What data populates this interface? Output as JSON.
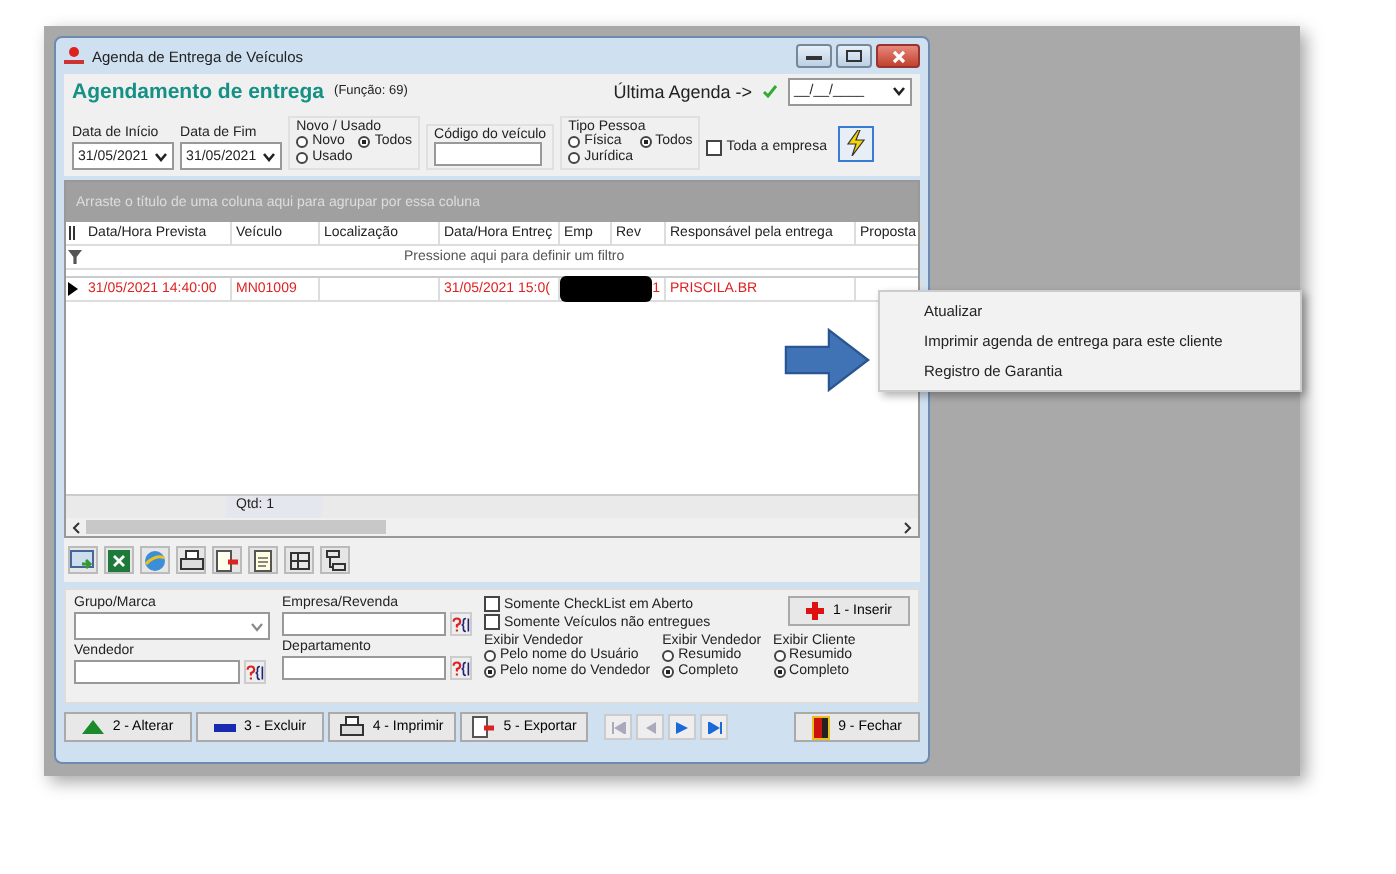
{
  "window": {
    "title": "Agenda de Entrega de Veículos"
  },
  "header": {
    "title": "Agendamento de entrega",
    "function": "(Função: 69)",
    "last_agenda_label": "Última Agenda ->",
    "last_agenda_value": "__/__/____"
  },
  "filters": {
    "start_date": {
      "label": "Data de Início",
      "value": "31/05/2021"
    },
    "end_date": {
      "label": "Data de Fim",
      "value": "31/05/2021"
    },
    "new_used": {
      "label": "Novo / Usado",
      "options": [
        {
          "label": "Novo",
          "selected": false
        },
        {
          "label": "Todos",
          "selected": true
        },
        {
          "label": "Usado",
          "selected": false
        }
      ]
    },
    "vehicle_code": {
      "label": "Código do veículo"
    },
    "person_type": {
      "label": "Tipo Pessoa",
      "options": [
        {
          "label": "Física",
          "selected": false
        },
        {
          "label": "Todos",
          "selected": true
        },
        {
          "label": "Jurídica",
          "selected": false
        }
      ]
    },
    "whole_company": {
      "label": "Toda a empresa",
      "checked": false
    }
  },
  "grid": {
    "group_hint": "Arraste o título de uma coluna aqui para agrupar por essa coluna",
    "columns": [
      "Data/Hora Prevista",
      "Veículo",
      "Localização",
      "Data/Hora Entreç",
      "Emp",
      "Rev",
      "Responsável pela entrega",
      "Proposta"
    ],
    "filter_hint": "Pressione aqui para definir um filtro",
    "rows": [
      {
        "cells": [
          "31/05/2021 14:40:00",
          "MN01009",
          "",
          "31/05/2021 15:0(",
          "",
          "1",
          "PRISCILA.BR",
          ""
        ],
        "redacted": true
      }
    ],
    "count": "Qtd: 1"
  },
  "context_menu": [
    "Atualizar",
    "Imprimir agenda de entrega para este cliente",
    "Registro de Garantia"
  ],
  "bottom": {
    "group_brand": {
      "label": "Grupo/Marca"
    },
    "company": {
      "label": "Empresa/Revenda"
    },
    "seller": {
      "label": "Vendedor"
    },
    "department": {
      "label": "Departamento"
    },
    "checkboxes": [
      {
        "label": "Somente CheckList em Aberto",
        "checked": false
      },
      {
        "label": "Somente Veículos não entregues",
        "checked": false
      }
    ],
    "radio_groups": [
      {
        "label": "Exibir Vendedor",
        "options": [
          {
            "label": "Pelo nome do Usuário",
            "selected": false
          },
          {
            "label": "Pelo nome do Vendedor",
            "selected": true
          }
        ]
      },
      {
        "label": "Exibir Vendedor",
        "options": [
          {
            "label": "Resumido",
            "selected": false
          },
          {
            "label": "Completo",
            "selected": true
          }
        ]
      },
      {
        "label": "Exibir Cliente",
        "options": [
          {
            "label": "Resumido",
            "selected": false
          },
          {
            "label": "Completo",
            "selected": true
          }
        ]
      }
    ],
    "insert_button": "1 - Inserir"
  },
  "buttons": [
    {
      "kind": "alter",
      "label": "2 - Alterar"
    },
    {
      "kind": "delete",
      "label": "3 - Excluir"
    },
    {
      "kind": "print",
      "label": "4 - Imprimir"
    },
    {
      "kind": "export",
      "label": "5 - Exportar"
    }
  ],
  "close_button": "9 - Fechar"
}
